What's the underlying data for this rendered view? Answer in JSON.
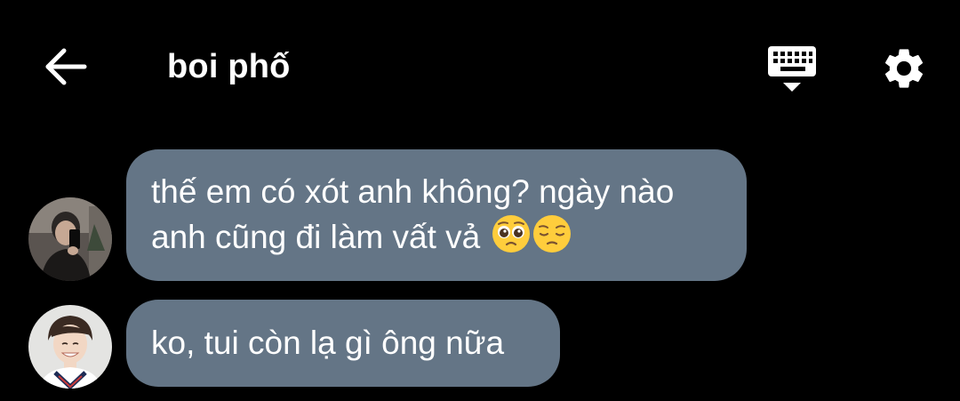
{
  "header": {
    "title": "boi phố",
    "back_icon": "arrow-left-icon",
    "keyboard_icon": "keyboard-icon",
    "settings_icon": "gear-icon"
  },
  "messages": [
    {
      "sender_avatar": "avatar-guy-mirror-selfie",
      "line1": "thế em có xót anh không? ngày nào",
      "line2": "anh cũng đi làm vất vả",
      "emojis": [
        "pleading-face-emoji",
        "pensive-face-emoji"
      ]
    },
    {
      "sender_avatar": "avatar-smiling-guy",
      "line1": "ko, tui còn lạ gì ông nữa"
    }
  ],
  "colors": {
    "background": "#000000",
    "bubble": "#647586",
    "text": "#ffffff",
    "emoji_face": "#ffcd3c"
  }
}
